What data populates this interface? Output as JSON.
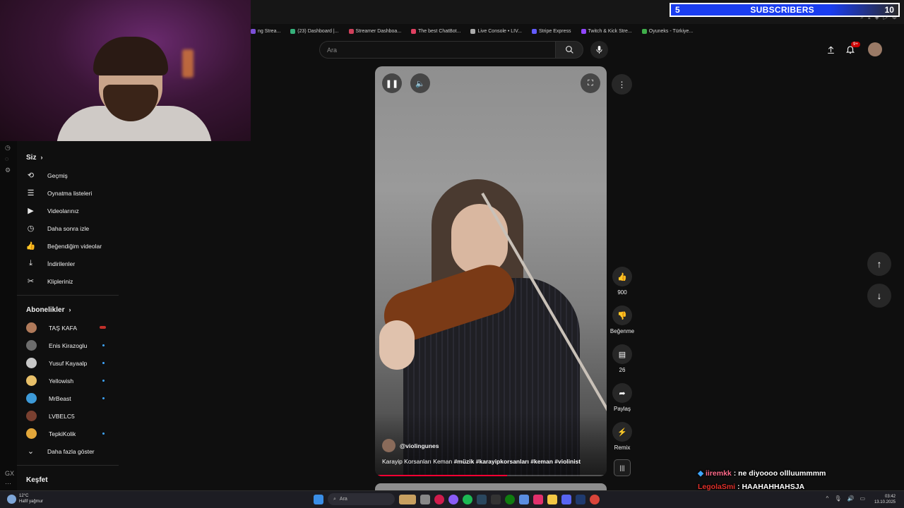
{
  "banner": {
    "count_left": "5",
    "label": "SUBSCRIBERS",
    "count_right": "10"
  },
  "bookmarks": [
    {
      "label": "ng Strea..."
    },
    {
      "label": "(23) Dashboard |..."
    },
    {
      "label": "Streamer Dashboa..."
    },
    {
      "label": "The best ChatBot..."
    },
    {
      "label": "Live Console • LIV..."
    },
    {
      "label": "Stripe Express"
    },
    {
      "label": "Twitch & Kick Stre..."
    },
    {
      "label": "Oyuneks - Türkiye..."
    }
  ],
  "search": {
    "placeholder": "Ara"
  },
  "header": {
    "notification_badge": "9+"
  },
  "sidebar": {
    "you_title": "Siz",
    "you_items": [
      {
        "label": "Geçmiş",
        "icon": "history-icon",
        "glyph": "⟲"
      },
      {
        "label": "Oynatma listeleri",
        "icon": "playlists-icon",
        "glyph": "☰"
      },
      {
        "label": "Videolarınız",
        "icon": "your-videos-icon",
        "glyph": "▶"
      },
      {
        "label": "Daha sonra izle",
        "icon": "watch-later-icon",
        "glyph": "◷"
      },
      {
        "label": "Beğendiğim videolar",
        "icon": "liked-icon",
        "glyph": "👍"
      },
      {
        "label": "İndirilenler",
        "icon": "downloads-icon",
        "glyph": "⤓"
      },
      {
        "label": "Klipleriniz",
        "icon": "clips-icon",
        "glyph": "✂"
      }
    ],
    "subs_title": "Abonelikler",
    "subscriptions": [
      {
        "label": "TAŞ KAFA",
        "color": "#b07a5a",
        "live": true
      },
      {
        "label": "Enis Kirazoglu",
        "color": "#6d6d6d",
        "dot": true
      },
      {
        "label": "Yusuf Kayaalp",
        "color": "#c8c8c8",
        "dot": true
      },
      {
        "label": "Yellowish",
        "color": "#e8c069",
        "dot": true
      },
      {
        "label": "MrBeast",
        "color": "#3d9ad8",
        "dot": true
      },
      {
        "label": "LVBELC5",
        "color": "#7a4030",
        "dot": false
      },
      {
        "label": "TepkiKolik",
        "color": "#e3a73a",
        "dot": true
      }
    ],
    "show_more": "Daha fazla göster",
    "explore_title": "Keşfet"
  },
  "video": {
    "channel": "@violingunes",
    "caption_plain": "Karayip Korsanları Keman ",
    "caption_tags": "#müzik #karayipkorsanları #keman #violinist",
    "progress": 0.57
  },
  "actions": {
    "like_count": "900",
    "dislike_label": "Beğenme",
    "comment_count": "26",
    "share_label": "Paylaş",
    "remix_label": "Remix"
  },
  "chat": [
    {
      "user": "iiremkk",
      "message": ": ne diyoooo ollluummmm"
    },
    {
      "user": "LegolaSmi",
      "message": ": HAAHAHHAHSJA"
    }
  ],
  "taskbar": {
    "temperature": "12°C",
    "weather": "Hafif yağmur",
    "search_label": "Ara",
    "time": "03:42",
    "date": "13.10.2025"
  }
}
